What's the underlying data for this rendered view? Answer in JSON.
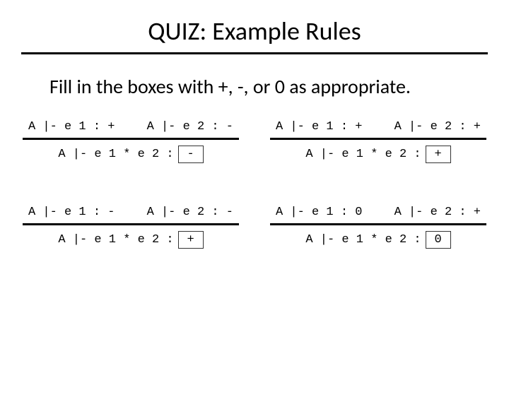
{
  "title": "QUIZ: Example Rules",
  "subtitle": "Fill in the boxes with +, -, or 0 as appropriate.",
  "rules": [
    {
      "prem1": "A |- e 1 : +",
      "prem2": "A |- e 2 : -",
      "concl": "A |- e 1 * e 2 :",
      "answer": "-"
    },
    {
      "prem1": "A |- e 1 : +",
      "prem2": "A |- e 2 : +",
      "concl": "A |- e 1 * e 2 :",
      "answer": "+"
    },
    {
      "prem1": "A |- e 1 : -",
      "prem2": "A |- e 2 : -",
      "concl": "A |- e 1 * e 2 :",
      "answer": "+"
    },
    {
      "prem1": "A |- e 1 : 0",
      "prem2": "A |- e 2 : +",
      "concl": "A |- e 1 * e 2 :",
      "answer": "0"
    }
  ]
}
